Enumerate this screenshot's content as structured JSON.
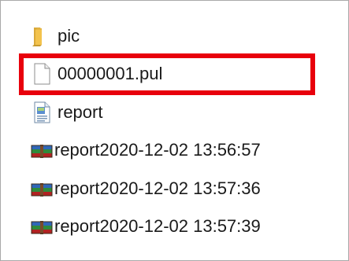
{
  "files": [
    {
      "name": "pic",
      "icon": "folder-icon"
    },
    {
      "name": "00000001.pul",
      "icon": "file-icon"
    },
    {
      "name": "report",
      "icon": "shortcut-document-icon"
    },
    {
      "name": "report2020-12-02 13:56:57",
      "icon": "archive-icon"
    },
    {
      "name": "report2020-12-02 13:57:36",
      "icon": "archive-icon"
    },
    {
      "name": "report2020-12-02 13:57:39",
      "icon": "archive-icon"
    }
  ],
  "highlight": {
    "target": "00000001.pul",
    "color": "#e8000c"
  },
  "colors": {
    "folder": "#f3c34d",
    "archive_blue": "#2f67b8",
    "archive_green": "#2f8a3b",
    "archive_red": "#b22222"
  }
}
